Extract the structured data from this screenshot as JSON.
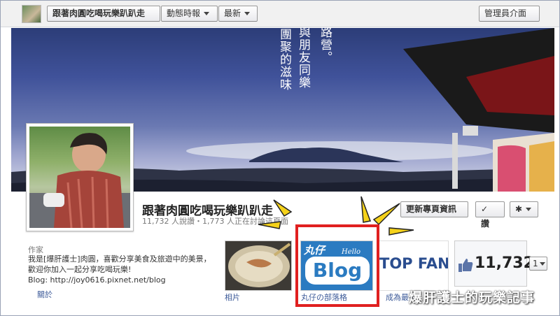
{
  "topbar": {
    "page_title": "跟著肉圓吃喝玩樂趴趴走",
    "news_feed": "動態時報",
    "latest": "最新",
    "admin_panel": "管理員介面"
  },
  "cover": {
    "caption_lines": [
      "路營。",
      "與朋友同樂",
      "團聚的滋味"
    ]
  },
  "page": {
    "name": "跟著肉圓吃喝玩樂趴趴走",
    "stats": "11,732 人說讚・1,773 人正在討論這頁面",
    "update_info": "更新專頁資訊",
    "like_label": "讚",
    "like_check": "✓",
    "gear": "✱"
  },
  "about": {
    "label": "作家",
    "text": "我是[爆肝護士]肉圓，喜歡分享美食及旅遊中的美景，歡迎你加入一起分享吃喝玩樂!",
    "blog": "Blog: http://joy0616.pixnet.net/blog",
    "about_link": "關於"
  },
  "tiles": {
    "photos_label": "相片",
    "blog_label": "丸仔の部落格",
    "blog_logo_top": "丸仔",
    "blog_logo_hello": "Hello",
    "blog_logo_main": "Blog",
    "fans_text": "TOP FANS",
    "fans_label": "成為最強",
    "like_count": "11,732",
    "page_selector": "1"
  },
  "watermark": "爆肝護士的玩樂記事",
  "colors": {
    "fb_blue": "#3b5998",
    "highlight_red": "#e02020",
    "annotation_yellow": "#f5d21a"
  }
}
